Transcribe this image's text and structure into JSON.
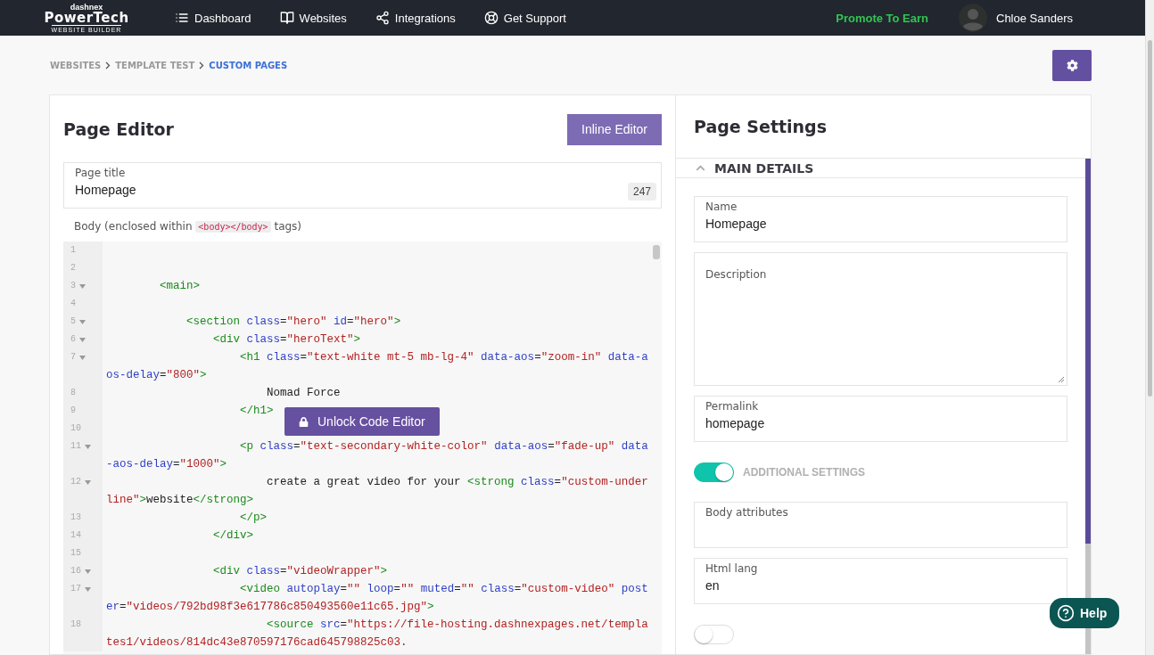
{
  "nav": {
    "logo": {
      "top": "dashnex",
      "main": "PowerTech",
      "sub": "WEBSITE BUILDER"
    },
    "items": [
      {
        "label": "Dashboard"
      },
      {
        "label": "Websites"
      },
      {
        "label": "Integrations"
      },
      {
        "label": "Get Support"
      }
    ],
    "promo": "Promote To Earn",
    "user": "Chloe Sanders"
  },
  "breadcrumb": [
    {
      "label": "WEBSITES",
      "current": false
    },
    {
      "label": "TEMPLATE TEST",
      "current": false
    },
    {
      "label": "CUSTOM PAGES",
      "current": true
    }
  ],
  "editor": {
    "title": "Page Editor",
    "inline_button": "Inline Editor",
    "page_title": {
      "label": "Page title",
      "value": "Homepage",
      "count": "247"
    },
    "body_label": {
      "before": "Body (enclosed within ",
      "code": "<body></body>",
      "after": " tags)"
    },
    "unlock_button": "Unlock Code Editor",
    "lines": [
      {
        "number": "1",
        "fold": false
      },
      {
        "number": "2",
        "fold": false
      },
      {
        "number": "3",
        "fold": true,
        "segments": [
          {
            "kind": "tag",
            "text": "        <main>"
          }
        ]
      },
      {
        "number": "4",
        "fold": false
      },
      {
        "number": "5",
        "fold": true,
        "segments": [
          {
            "kind": "tag",
            "text": "            <section"
          },
          {
            "kind": "attr",
            "text": " class"
          },
          {
            "kind": "text",
            "text": "="
          },
          {
            "kind": "string",
            "text": "\"hero\""
          },
          {
            "kind": "attr",
            "text": " id"
          },
          {
            "kind": "text",
            "text": "="
          },
          {
            "kind": "string",
            "text": "\"hero\""
          },
          {
            "kind": "tag",
            "text": ">"
          }
        ]
      },
      {
        "number": "6",
        "fold": true,
        "segments": [
          {
            "kind": "tag",
            "text": "                <div"
          },
          {
            "kind": "attr",
            "text": " class"
          },
          {
            "kind": "text",
            "text": "="
          },
          {
            "kind": "string",
            "text": "\"heroText\""
          },
          {
            "kind": "tag",
            "text": ">"
          }
        ]
      },
      {
        "number": "7",
        "fold": true,
        "segments": [
          {
            "kind": "tag",
            "text": "                    <h1"
          },
          {
            "kind": "attr",
            "text": " class"
          },
          {
            "kind": "text",
            "text": "="
          },
          {
            "kind": "string",
            "text": "\"text-white mt-5 mb-lg-4\""
          },
          {
            "kind": "attr",
            "text": " data-aos"
          },
          {
            "kind": "text",
            "text": "="
          },
          {
            "kind": "string",
            "text": "\"zoom-in\""
          },
          {
            "kind": "attr",
            "text": " data-aos-delay"
          },
          {
            "kind": "text",
            "text": "="
          },
          {
            "kind": "string",
            "text": "\"800\""
          },
          {
            "kind": "tag",
            "text": ">"
          }
        ]
      },
      {
        "number": "8",
        "fold": false,
        "segments": [
          {
            "kind": "text",
            "text": "                        Nomad Force"
          }
        ]
      },
      {
        "number": "9",
        "fold": false,
        "segments": [
          {
            "kind": "tag",
            "text": "                    </h1>"
          }
        ]
      },
      {
        "number": "10",
        "fold": false
      },
      {
        "number": "11",
        "fold": true,
        "segments": [
          {
            "kind": "tag",
            "text": "                    <p"
          },
          {
            "kind": "attr",
            "text": " class"
          },
          {
            "kind": "text",
            "text": "="
          },
          {
            "kind": "string",
            "text": "\"text-secondary-white-color\""
          },
          {
            "kind": "attr",
            "text": " data-aos"
          },
          {
            "kind": "text",
            "text": "="
          },
          {
            "kind": "string",
            "text": "\"fade-up\""
          },
          {
            "kind": "attr",
            "text": " data-aos-delay"
          },
          {
            "kind": "text",
            "text": "="
          },
          {
            "kind": "string",
            "text": "\"1000\""
          },
          {
            "kind": "tag",
            "text": ">"
          }
        ]
      },
      {
        "number": "12",
        "fold": true,
        "segments": [
          {
            "kind": "text",
            "text": "                        create a great video for your "
          },
          {
            "kind": "tag",
            "text": "<strong"
          },
          {
            "kind": "attr",
            "text": " class"
          },
          {
            "kind": "text",
            "text": "="
          },
          {
            "kind": "string",
            "text": "\"custom-underline\""
          },
          {
            "kind": "tag",
            "text": ">"
          },
          {
            "kind": "text",
            "text": "website"
          },
          {
            "kind": "tag",
            "text": "</strong>"
          }
        ]
      },
      {
        "number": "13",
        "fold": false,
        "segments": [
          {
            "kind": "tag",
            "text": "                    </p>"
          }
        ]
      },
      {
        "number": "14",
        "fold": false,
        "segments": [
          {
            "kind": "tag",
            "text": "                </div>"
          }
        ]
      },
      {
        "number": "15",
        "fold": false
      },
      {
        "number": "16",
        "fold": true,
        "segments": [
          {
            "kind": "tag",
            "text": "                <div"
          },
          {
            "kind": "attr",
            "text": " class"
          },
          {
            "kind": "text",
            "text": "="
          },
          {
            "kind": "string",
            "text": "\"videoWrapper\""
          },
          {
            "kind": "tag",
            "text": ">"
          }
        ]
      },
      {
        "number": "17",
        "fold": true,
        "segments": [
          {
            "kind": "tag",
            "text": "                    <video"
          },
          {
            "kind": "attr",
            "text": " autoplay"
          },
          {
            "kind": "text",
            "text": "="
          },
          {
            "kind": "string",
            "text": "\"\""
          },
          {
            "kind": "attr",
            "text": " loop"
          },
          {
            "kind": "text",
            "text": "="
          },
          {
            "kind": "string",
            "text": "\"\""
          },
          {
            "kind": "attr",
            "text": " muted"
          },
          {
            "kind": "text",
            "text": "="
          },
          {
            "kind": "string",
            "text": "\"\""
          },
          {
            "kind": "attr",
            "text": " class"
          },
          {
            "kind": "text",
            "text": "="
          },
          {
            "kind": "string",
            "text": "\"custom-video\""
          },
          {
            "kind": "attr",
            "text": " poster"
          },
          {
            "kind": "text",
            "text": "="
          },
          {
            "kind": "string",
            "text": "\"videos/792bd98f3e617786c850493560e11c65.jpg\""
          },
          {
            "kind": "tag",
            "text": ">"
          }
        ]
      },
      {
        "number": "18",
        "fold": false,
        "segments": [
          {
            "kind": "tag",
            "text": "                        <source"
          },
          {
            "kind": "attr",
            "text": " src"
          },
          {
            "kind": "text",
            "text": "="
          },
          {
            "kind": "string",
            "text": "\"https://file-hosting.dashnexpages.net/templates1/videos/814dc43e870597176cad645798825c03."
          }
        ]
      }
    ]
  },
  "settings": {
    "title": "Page Settings",
    "section": {
      "label": "MAIN DETAILS",
      "expanded": true
    },
    "items": [
      {
        "kind": "field",
        "label": "Name",
        "value": "Homepage"
      },
      {
        "kind": "textarea",
        "label": "Description"
      },
      {
        "kind": "field",
        "label": "Permalink",
        "value": "homepage"
      },
      {
        "kind": "toggle",
        "label": "ADDITIONAL SETTINGS",
        "on": true
      },
      {
        "kind": "field",
        "label": "Body attributes"
      },
      {
        "kind": "field",
        "label": "Html lang",
        "value": "en"
      },
      {
        "kind": "toggle",
        "on": false
      }
    ]
  },
  "help": "Help"
}
